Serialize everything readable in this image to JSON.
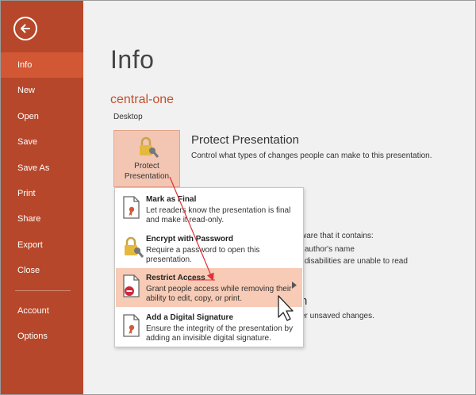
{
  "sidebar": {
    "items": [
      {
        "label": "Info",
        "active": true
      },
      {
        "label": "New"
      },
      {
        "label": "Open"
      },
      {
        "label": "Save"
      },
      {
        "label": "Save As"
      },
      {
        "label": "Print"
      },
      {
        "label": "Share"
      },
      {
        "label": "Export"
      },
      {
        "label": "Close"
      },
      {
        "label": "Account"
      },
      {
        "label": "Options"
      }
    ]
  },
  "main": {
    "title": "Info",
    "doc_name": "central-one",
    "doc_location": "Desktop",
    "protect_button_line1": "Protect",
    "protect_button_line2": "Presentation",
    "protect_title": "Protect Presentation",
    "protect_desc": "Control what types of changes people can make to this presentation.",
    "inspect_line1": "ware that it contains:",
    "inspect_line2": "author's name",
    "inspect_line3": "disabilities are unable to read",
    "versions_title": "n",
    "versions_desc": "er unsaved changes."
  },
  "menu": {
    "items": [
      {
        "title": "Mark as Final",
        "desc": "Let readers know the presentation is final and make it read-only."
      },
      {
        "title": "Encrypt with Password",
        "desc": "Require a password to open this presentation."
      },
      {
        "title": "Restrict Access",
        "desc": "Grant people access while removing their ability to edit, copy, or print."
      },
      {
        "title": "Add a Digital Signature",
        "desc": "Ensure the integrity of the presentation by adding an invisible digital signature."
      }
    ]
  },
  "colors": {
    "sidebar": "#b7472a",
    "sidebar_active": "#d25835",
    "accent_text": "#c4502b",
    "highlight": "#f7cbb5",
    "annotation": "#e0303a"
  }
}
